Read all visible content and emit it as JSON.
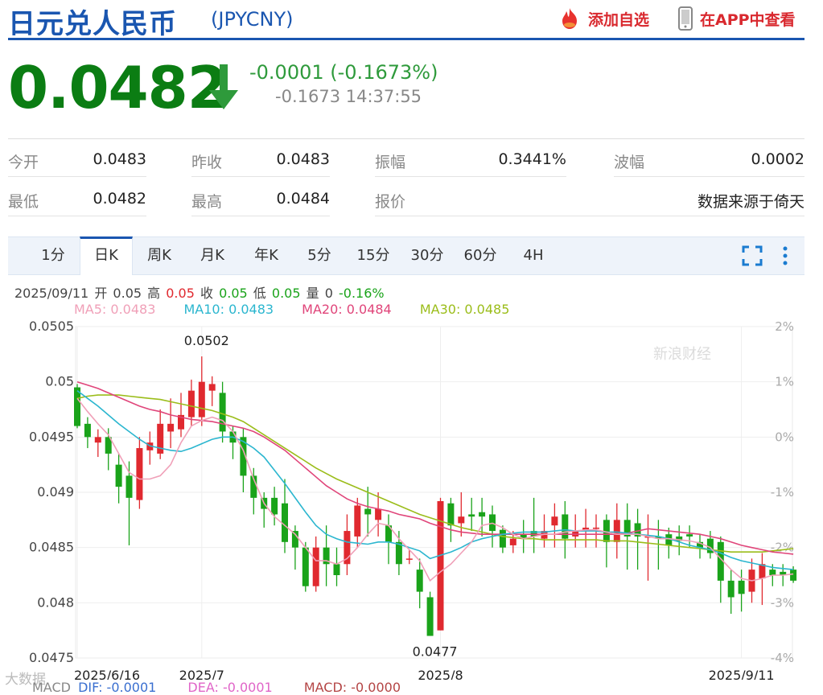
{
  "header": {
    "title": "日元兑人民币",
    "symbol": "(JPYCNY)",
    "watchlist_label": "添加自选",
    "app_label": "在APP中查看"
  },
  "quote": {
    "price": "0.0482",
    "change": "-0.0001 (-0.1673%)",
    "sub": "-0.1673 14:37:55"
  },
  "stats": {
    "row1": [
      {
        "label": "今开",
        "value": "0.0483"
      },
      {
        "label": "昨收",
        "value": "0.0483"
      },
      {
        "label": "振幅",
        "value": "0.3441%"
      },
      {
        "label": "波幅",
        "value": "0.0002"
      }
    ],
    "row2": [
      {
        "label": "最低",
        "value": "0.0482"
      },
      {
        "label": "最高",
        "value": "0.0484"
      },
      {
        "label": "报价",
        "value": "数据来源于倚天"
      }
    ]
  },
  "tabs": [
    "1分",
    "日K",
    "周K",
    "月K",
    "年K",
    "5分",
    "15分",
    "30分",
    "60分",
    "4H"
  ],
  "active_tab": "日K",
  "info": {
    "date": "2025/09/11",
    "open_label": "开",
    "open": "0.05",
    "high_label": "高",
    "high": "0.05",
    "close_label": "收",
    "close": "0.05",
    "low_label": "低",
    "low": "0.05",
    "vol_label": "量",
    "vol": "0",
    "pct": "-0.16%"
  },
  "ma": {
    "ma5": "MA5: 0.0483",
    "ma10": "MA10: 0.0483",
    "ma20": "MA20: 0.0484",
    "ma30": "MA30: 0.0485"
  },
  "macd": {
    "label": "MACD",
    "dif": "DIF: -0.0001",
    "dea": "DEA: -0.0001",
    "macd": "MACD: -0.0000"
  },
  "watermark": {
    "brand": "新浪财经",
    "bottom": "大数据"
  },
  "colors": {
    "up": "#e0292f",
    "down": "#1aa31a",
    "ma5": "#f0a0b8",
    "ma10": "#2bb6cf",
    "ma20": "#e0457a",
    "ma30": "#9bbd1a",
    "accent": "#1a56b0"
  },
  "chart_data": {
    "type": "candlestick",
    "ylim": [
      0.0475,
      0.0505
    ],
    "y_ticks": [
      "0.0505",
      "0.05",
      "0.0495",
      "0.049",
      "0.0485",
      "0.048",
      "0.0475"
    ],
    "y_ticks_right": [
      "2%",
      "1%",
      "0%",
      "-1%",
      "-2%",
      "-3%",
      "-4%"
    ],
    "x_labels": [
      {
        "label": "2025/6/16",
        "index": 0
      },
      {
        "label": "2025/7",
        "index": 12
      },
      {
        "label": "2025/8",
        "index": 35
      },
      {
        "label": "2025/9/11",
        "index": 64
      }
    ],
    "annotations": [
      {
        "text": "0.0502",
        "index": 12,
        "value": 0.05023
      },
      {
        "text": "0.0477",
        "index": 34,
        "value": 0.0477
      }
    ],
    "candles": [
      [
        0.04995,
        0.0496,
        0.04998,
        0.04958
      ],
      [
        0.04962,
        0.0495,
        0.04968,
        0.0494
      ],
      [
        0.04945,
        0.0495,
        0.04957,
        0.04932
      ],
      [
        0.0495,
        0.04935,
        0.04958,
        0.0492
      ],
      [
        0.04925,
        0.04905,
        0.04935,
        0.0489
      ],
      [
        0.04915,
        0.04895,
        0.04928,
        0.04852
      ],
      [
        0.04893,
        0.0494,
        0.0495,
        0.04885
      ],
      [
        0.04938,
        0.04945,
        0.04955,
        0.04925
      ],
      [
        0.04935,
        0.04962,
        0.04975,
        0.0493
      ],
      [
        0.04955,
        0.04962,
        0.04985,
        0.0494
      ],
      [
        0.04957,
        0.0497,
        0.0499,
        0.0495
      ],
      [
        0.04968,
        0.04992,
        0.05002,
        0.0496
      ],
      [
        0.04968,
        0.05,
        0.05023,
        0.0496
      ],
      [
        0.04992,
        0.04998,
        0.05005,
        0.04978
      ],
      [
        0.0499,
        0.04955,
        0.05,
        0.04945
      ],
      [
        0.04955,
        0.04945,
        0.0496,
        0.0493
      ],
      [
        0.0495,
        0.04915,
        0.04958,
        0.049
      ],
      [
        0.04915,
        0.04895,
        0.04922,
        0.0488
      ],
      [
        0.04895,
        0.04885,
        0.049,
        0.04868
      ],
      [
        0.04895,
        0.0488,
        0.04905,
        0.0487
      ],
      [
        0.0489,
        0.04855,
        0.04912,
        0.04845
      ],
      [
        0.04865,
        0.0485,
        0.0487,
        0.0483
      ],
      [
        0.0485,
        0.04815,
        0.04855,
        0.0481
      ],
      [
        0.04815,
        0.0485,
        0.0486,
        0.0481
      ],
      [
        0.0485,
        0.04835,
        0.0487,
        0.04815
      ],
      [
        0.04835,
        0.04825,
        0.0485,
        0.04815
      ],
      [
        0.04835,
        0.04865,
        0.0488,
        0.04825
      ],
      [
        0.0486,
        0.04888,
        0.04895,
        0.0485
      ],
      [
        0.04885,
        0.0488,
        0.04905,
        0.0486
      ],
      [
        0.04875,
        0.04885,
        0.049,
        0.0486
      ],
      [
        0.0487,
        0.04855,
        0.0488,
        0.04835
      ],
      [
        0.04855,
        0.04835,
        0.04865,
        0.04825
      ],
      [
        0.0484,
        0.0484,
        0.04848,
        0.04835
      ],
      [
        0.0483,
        0.0481,
        0.0484,
        0.04795
      ],
      [
        0.04805,
        0.0477,
        0.0481,
        0.0477
      ],
      [
        0.04775,
        0.04892,
        0.04895,
        0.04775
      ],
      [
        0.0489,
        0.0487,
        0.04895,
        0.04855
      ],
      [
        0.04872,
        0.04878,
        0.049,
        0.0486
      ],
      [
        0.0488,
        0.04878,
        0.04895,
        0.04865
      ],
      [
        0.04882,
        0.04878,
        0.04895,
        0.0486
      ],
      [
        0.0488,
        0.04865,
        0.04888,
        0.0485
      ],
      [
        0.04866,
        0.0485,
        0.0487,
        0.04845
      ],
      [
        0.04852,
        0.04858,
        0.04865,
        0.04845
      ],
      [
        0.04862,
        0.04858,
        0.04875,
        0.04845
      ],
      [
        0.04865,
        0.0486,
        0.04895,
        0.04845
      ],
      [
        0.04858,
        0.04865,
        0.0488,
        0.0485
      ],
      [
        0.0487,
        0.04878,
        0.0489,
        0.0485
      ],
      [
        0.0488,
        0.04858,
        0.04892,
        0.0484
      ],
      [
        0.0486,
        0.04865,
        0.0488,
        0.0485
      ],
      [
        0.04865,
        0.04868,
        0.04885,
        0.0485
      ],
      [
        0.04868,
        0.04868,
        0.0488,
        0.0485
      ],
      [
        0.04875,
        0.04855,
        0.0488,
        0.04832
      ],
      [
        0.04855,
        0.04875,
        0.0489,
        0.0484
      ],
      [
        0.04875,
        0.0486,
        0.0489,
        0.0483
      ],
      [
        0.04872,
        0.0486,
        0.04885,
        0.0483
      ],
      [
        0.0486,
        0.0486,
        0.0488,
        0.0482
      ],
      [
        0.0486,
        0.04858,
        0.04875,
        0.0483
      ],
      [
        0.04862,
        0.04852,
        0.04868,
        0.0484
      ],
      [
        0.0486,
        0.04856,
        0.0487,
        0.04843
      ],
      [
        0.04862,
        0.0486,
        0.0487,
        0.0485
      ],
      [
        0.04855,
        0.0485,
        0.04862,
        0.0484
      ],
      [
        0.04858,
        0.04845,
        0.04865,
        0.0484
      ],
      [
        0.04855,
        0.0482,
        0.0486,
        0.048
      ],
      [
        0.0482,
        0.04805,
        0.0483,
        0.0479
      ],
      [
        0.0482,
        0.04808,
        0.0483,
        0.04792
      ],
      [
        0.0481,
        0.0483,
        0.0484,
        0.048
      ],
      [
        0.04822,
        0.04835,
        0.04845,
        0.04798
      ],
      [
        0.0483,
        0.04825,
        0.04835,
        0.04815
      ],
      [
        0.04828,
        0.04825,
        0.04835,
        0.04815
      ],
      [
        0.0483,
        0.0482,
        0.04833,
        0.04818
      ]
    ],
    "ma5": [
      0.04985,
      0.04973,
      0.04962,
      0.04952,
      0.04935,
      0.04918,
      0.04912,
      0.04912,
      0.04915,
      0.04925,
      0.04945,
      0.0496,
      0.04965,
      0.04968,
      0.04965,
      0.04955,
      0.04938,
      0.04912,
      0.0489,
      0.04878,
      0.0487,
      0.04862,
      0.0485,
      0.04838,
      0.04838,
      0.04835,
      0.0484,
      0.0485,
      0.04862,
      0.04872,
      0.0487,
      0.04858,
      0.04848,
      0.04838,
      0.0482,
      0.04828,
      0.04835,
      0.04845,
      0.04855,
      0.0487,
      0.04872,
      0.04868,
      0.04862,
      0.04858,
      0.0486,
      0.04862,
      0.04862,
      0.04864,
      0.04865,
      0.04866,
      0.04866,
      0.04864,
      0.04862,
      0.04862,
      0.04862,
      0.0486,
      0.04858,
      0.04858,
      0.04857,
      0.04856,
      0.04854,
      0.0485,
      0.0484,
      0.0483,
      0.04822,
      0.0482,
      0.04822,
      0.04825,
      0.04825,
      0.04826
    ],
    "ma10": [
      0.04992,
      0.04985,
      0.04978,
      0.0497,
      0.04962,
      0.04955,
      0.04948,
      0.04942,
      0.0494,
      0.04938,
      0.04937,
      0.0494,
      0.04944,
      0.04948,
      0.0495,
      0.0495,
      0.04946,
      0.0494,
      0.04932,
      0.0492,
      0.04908,
      0.04895,
      0.04882,
      0.0487,
      0.04862,
      0.04858,
      0.04855,
      0.04854,
      0.04853,
      0.04855,
      0.04855,
      0.04853,
      0.0485,
      0.04847,
      0.0484,
      0.04843,
      0.04846,
      0.0485,
      0.04855,
      0.04858,
      0.0486,
      0.04862,
      0.04863,
      0.04864,
      0.04864,
      0.04864,
      0.04865,
      0.04866,
      0.04865,
      0.04865,
      0.04865,
      0.04864,
      0.04864,
      0.04863,
      0.04862,
      0.04861,
      0.0486,
      0.04858,
      0.04855,
      0.04852,
      0.0485,
      0.04848,
      0.04845,
      0.04841,
      0.04838,
      0.04836,
      0.04834,
      0.04832,
      0.04831,
      0.0483
    ],
    "ma20": [
      0.05,
      0.04997,
      0.04994,
      0.0499,
      0.04986,
      0.04982,
      0.04978,
      0.04975,
      0.04973,
      0.0497,
      0.04968,
      0.04966,
      0.04965,
      0.04964,
      0.04962,
      0.0496,
      0.04958,
      0.04955,
      0.0495,
      0.04944,
      0.04938,
      0.0493,
      0.04922,
      0.04914,
      0.04906,
      0.049,
      0.04894,
      0.0489,
      0.04887,
      0.04885,
      0.04883,
      0.0488,
      0.04878,
      0.04876,
      0.04872,
      0.04869,
      0.04866,
      0.04864,
      0.04863,
      0.04862,
      0.04862,
      0.04862,
      0.04862,
      0.04862,
      0.04862,
      0.04862,
      0.04862,
      0.04862,
      0.04862,
      0.04862,
      0.04862,
      0.04862,
      0.04862,
      0.04863,
      0.04865,
      0.04867,
      0.04866,
      0.04865,
      0.04864,
      0.04863,
      0.04862,
      0.0486,
      0.04858,
      0.04855,
      0.04852,
      0.0485,
      0.04848,
      0.04846,
      0.04845,
      0.04844
    ],
    "ma30": [
      0.04985,
      0.04987,
      0.04988,
      0.04988,
      0.04988,
      0.04987,
      0.04986,
      0.04985,
      0.04984,
      0.04982,
      0.0498,
      0.04978,
      0.04976,
      0.04974,
      0.04971,
      0.04968,
      0.04964,
      0.04958,
      0.04952,
      0.04946,
      0.0494,
      0.04934,
      0.04928,
      0.04922,
      0.04917,
      0.04912,
      0.04908,
      0.04904,
      0.049,
      0.04896,
      0.04892,
      0.04888,
      0.04884,
      0.0488,
      0.04877,
      0.04874,
      0.04871,
      0.04868,
      0.04866,
      0.04864,
      0.04862,
      0.0486,
      0.04859,
      0.04858,
      0.04858,
      0.04857,
      0.04857,
      0.04857,
      0.04857,
      0.04857,
      0.04857,
      0.04856,
      0.04856,
      0.04856,
      0.04855,
      0.04854,
      0.04853,
      0.04852,
      0.04851,
      0.0485,
      0.04849,
      0.04848,
      0.04847,
      0.04846,
      0.04846,
      0.04846,
      0.04846,
      0.04847,
      0.04848,
      0.04849
    ]
  }
}
